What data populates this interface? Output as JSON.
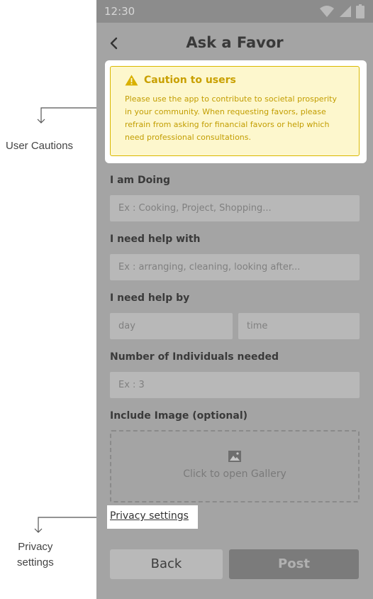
{
  "annotations": {
    "user_cautions": "User Cautions",
    "privacy_settings_line1": "Privacy",
    "privacy_settings_line2": "settings"
  },
  "status_bar": {
    "time": "12:30",
    "icons": [
      "wifi-icon",
      "signal-icon",
      "battery-icon"
    ]
  },
  "header": {
    "title": "Ask a Favor",
    "back_icon": "chevron-left-icon"
  },
  "caution": {
    "title": "Caution to users",
    "icon": "warning-icon",
    "lines": [
      "Please use the app to contribute to societal prosperity",
      "in your community. When requesting favors, please",
      "refrain from asking for financial favors or help which",
      "need professional consultations."
    ]
  },
  "form": {
    "doing_label": "I am Doing",
    "doing_placeholder": "Ex : Cooking, Project, Shopping...",
    "help_label": "I need help with",
    "help_placeholder": "Ex : arranging, cleaning, looking after...",
    "by_label": "I need help by",
    "day_placeholder": "day",
    "time_placeholder": "time",
    "individuals_label": "Number of Individuals needed",
    "individuals_placeholder": "Ex : 3",
    "image_label": "Include Image (optional)",
    "gallery_label": "Click to open Gallery",
    "gallery_icon": "image-icon"
  },
  "privacy_link": "Privacy settings",
  "buttons": {
    "back": "Back",
    "post": "Post"
  },
  "colors": {
    "caution_bg": "#fdf7cd",
    "caution_border": "#d9b800",
    "caution_text": "#c29d00"
  }
}
